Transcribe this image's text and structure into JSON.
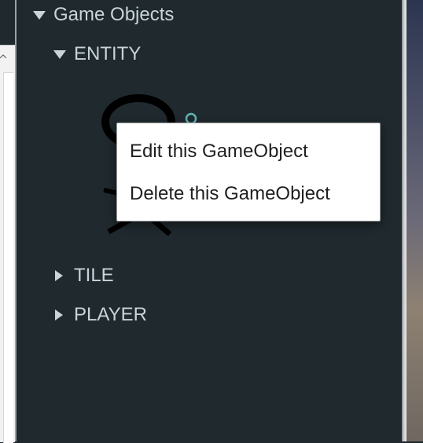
{
  "tree": {
    "root": {
      "label": "Game Objects",
      "icon": "triangle-down-icon"
    },
    "groups": [
      {
        "label": "ENTITY",
        "icon": "triangle-down-icon",
        "expanded": true
      },
      {
        "label": "TILE",
        "icon": "triangle-right-icon",
        "expanded": false
      },
      {
        "label": "PLAYER",
        "icon": "triangle-right-icon",
        "expanded": false
      }
    ]
  },
  "context_menu": {
    "items": [
      {
        "label": "Edit this GameObject"
      },
      {
        "label": "Delete this GameObject"
      }
    ]
  },
  "colors": {
    "panel_bg": "#1f292e",
    "tree_text": "#c8d4da",
    "menu_bg": "#ffffff",
    "menu_text": "#1f1f1f",
    "sprite_accent": "#5fb3b3"
  }
}
